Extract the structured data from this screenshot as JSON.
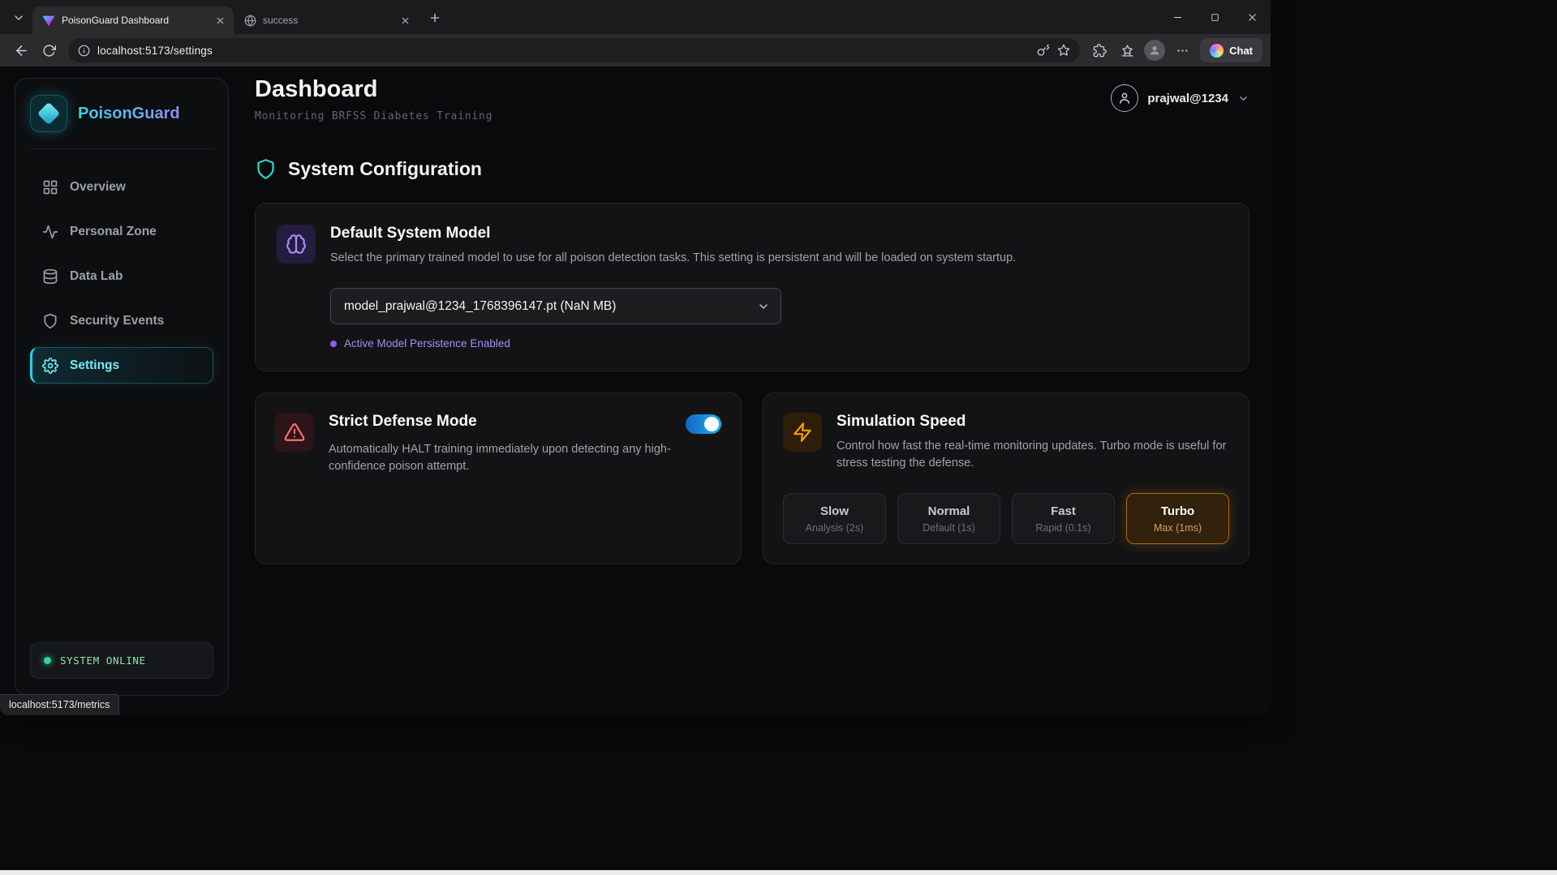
{
  "browser": {
    "tabs": [
      {
        "title": "PoisonGuard Dashboard"
      },
      {
        "title": "success"
      }
    ],
    "url": "localhost:5173/settings",
    "chat_label": "Chat"
  },
  "sidebar": {
    "brand": "PoisonGuard",
    "items": [
      {
        "label": "Overview"
      },
      {
        "label": "Personal Zone"
      },
      {
        "label": "Data Lab"
      },
      {
        "label": "Security Events"
      },
      {
        "label": "Settings"
      }
    ],
    "status_label": "SYSTEM ONLINE"
  },
  "header": {
    "title": "Dashboard",
    "subtitle": "Monitoring BRFSS Diabetes Training",
    "username": "prajwal@1234"
  },
  "settings": {
    "section_title": "System Configuration",
    "model_card": {
      "title": "Default System Model",
      "description": "Select the primary trained model to use for all poison detection tasks. This setting is persistent and will be loaded on system startup.",
      "selected_model": "model_prajwal@1234_1768396147.pt (NaN MB)",
      "status": "Active Model Persistence Enabled"
    },
    "defense_card": {
      "title": "Strict Defense Mode",
      "description": "Automatically HALT training immediately upon detecting any high-confidence poison attempt.",
      "enabled": true
    },
    "speed_card": {
      "title": "Simulation Speed",
      "description": "Control how fast the real-time monitoring updates. Turbo mode is useful for stress testing the defense.",
      "options": [
        {
          "label": "Slow",
          "sublabel": "Analysis (2s)",
          "selected": false
        },
        {
          "label": "Normal",
          "sublabel": "Default (1s)",
          "selected": false
        },
        {
          "label": "Fast",
          "sublabel": "Rapid (0.1s)",
          "selected": false
        },
        {
          "label": "Turbo",
          "sublabel": "Max (1ms)",
          "selected": true
        }
      ]
    }
  },
  "statusbar": {
    "link_preview": "localhost:5173/metrics"
  },
  "colors": {
    "accent_cyan": "#22d3ee",
    "accent_purple": "#a78bfa",
    "accent_orange": "#f59e0b",
    "accent_red": "#ef4444",
    "status_green": "#34d399",
    "toggle_blue": "#0ea5e9"
  }
}
